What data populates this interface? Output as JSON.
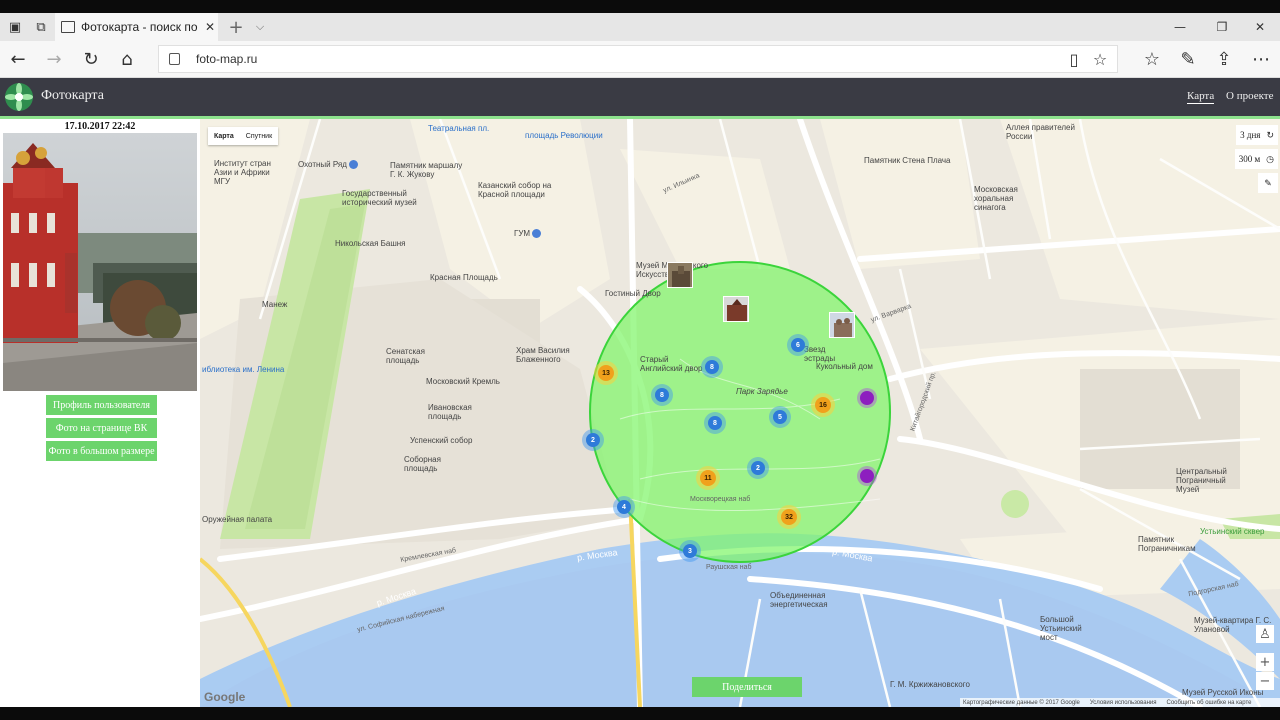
{
  "browser": {
    "tab_title": "Фотокарта - поиск по с",
    "tab_close": "✕",
    "new_tab": "+",
    "url": "foto-map.ru"
  },
  "site": {
    "brand": "Фотокарта",
    "nav": [
      {
        "label": "Карта",
        "active": true
      },
      {
        "label": "О проекте",
        "active": false
      }
    ]
  },
  "left_panel": {
    "datetime": "17.10.2017 22:42",
    "buttons": [
      "Профиль пользователя",
      "Фото на странице ВК",
      "Фото в большом размере"
    ]
  },
  "map": {
    "map_types": [
      "Карта",
      "Спутник"
    ],
    "time_filter": "3 дня",
    "radius_filter": "300 м",
    "share_label": "Поделиться",
    "google_label": "Google",
    "attribution": [
      "Картографические данные © 2017 Google",
      "Условия использования",
      "Сообщить об ошибке на карте"
    ],
    "zoom_in": "+",
    "zoom_out": "−",
    "labels": {
      "teatr": "Театральная пл.",
      "okhotny": "Охотный Ряд",
      "institut": "Институт стран Азии и Африки МГУ",
      "zhukov": "Памятник маршалу Г. К. Жукову",
      "revolution": "площадь Революции",
      "kazan": "Казанский собор на Красной площади",
      "ist_museum": "Государственный исторический музей",
      "gum": "ГУМ",
      "nikolskaya": "Никольская Башня",
      "red_sq": "Красная Площадь",
      "manezh": "Манеж",
      "senate": "Сенатская площадь",
      "vasily": "Храм Василия Блаженного",
      "kremlin": "Московский Кремль",
      "ivanovo": "Ивановская площадь",
      "uspensky": "Успенский собор",
      "cathedral_sq": "Соборная площадь",
      "armoury": "Оружейная палата",
      "gostiny": "Гостиный Двор",
      "museum_arts": "Музей Московского Искусства",
      "old_english": "Старый Английский двор",
      "zaryadye": "Парк Зарядье",
      "stars": "Звезд эстрады",
      "puppet": "Кукольный дом",
      "alley": "Аллея правителей России",
      "wailing": "Памятник Стена Плача",
      "synagogue": "Московская хоральная синагога",
      "border_museum": "Центральный Пограничный Музей",
      "border_monument": "Памятник Пограничникам",
      "ustinsky_sq": "Устьинский сквер",
      "energy": "Объединенная энергетическая",
      "bolshoy_ust": "Большой Устьинский мост",
      "ulanova": "Музей-квартира Г. С. Улановой",
      "krzhizh": "Г. М. Кржижановского",
      "russian_icons": "Музей Русской Иконы",
      "moskva1": "р. Москва",
      "moskva2": "р. Москва",
      "moskva3": "р. Москва",
      "lenin_lib": "иблиотека им. Ленина",
      "kitay_pr": "Китайгородский пр.",
      "moskvoretskaya": "Москворецкая наб",
      "kremlevskaya": "Кремлевская наб",
      "raushskaya": "Раушская наб",
      "sofiyskaya": "ул. Софийская набережная",
      "varvarka": "ул. Варварка",
      "ilyinka": "ул. Ильинка",
      "podgornskaya": "Подгорская наб"
    },
    "clusters": [
      {
        "label": "13",
        "kind": "yellow"
      },
      {
        "label": "8",
        "kind": "blue"
      },
      {
        "label": "6",
        "kind": "blue"
      },
      {
        "label": "8",
        "kind": "blue"
      },
      {
        "label": "8",
        "kind": "blue"
      },
      {
        "label": "5",
        "kind": "blue"
      },
      {
        "label": "16",
        "kind": "yellow"
      },
      {
        "label": "2",
        "kind": "blue"
      },
      {
        "label": "2",
        "kind": "blue"
      },
      {
        "label": "11",
        "kind": "yellow"
      },
      {
        "label": "4",
        "kind": "blue"
      },
      {
        "label": "32",
        "kind": "yellow"
      },
      {
        "label": "3",
        "kind": "blue"
      },
      {
        "label": "",
        "kind": "purple"
      },
      {
        "label": "",
        "kind": "purple"
      }
    ]
  },
  "colors": {
    "header_bg": "#3a3b44",
    "accent_green": "#6cd46c",
    "circle_fill": "#7ff56a",
    "water": "#a9c9f0",
    "cluster_blue": "#2e7bd9",
    "cluster_yellow": "#f0a11c",
    "cluster_purple": "#8d1fbf"
  }
}
